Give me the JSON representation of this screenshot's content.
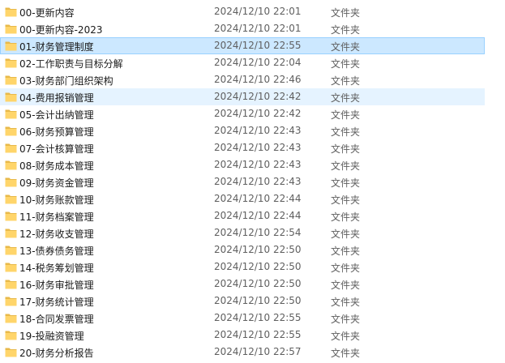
{
  "colors": {
    "selected_bg": "#cce8ff",
    "selected_border": "#99d1ff",
    "hover_bg": "#e5f3ff",
    "folder_fill": "#ffd56a",
    "folder_tab": "#e8b94a"
  },
  "rows": [
    {
      "name": "00-更新内容",
      "date": "2024/12/10 22:01",
      "type": "文件夹",
      "icon": "folder-icon",
      "state": ""
    },
    {
      "name": "00-更新内容-2023",
      "date": "2024/12/10 22:01",
      "type": "文件夹",
      "icon": "folder-icon",
      "state": ""
    },
    {
      "name": "01-财务管理制度",
      "date": "2024/12/10 22:55",
      "type": "文件夹",
      "icon": "folder-icon",
      "state": "selected"
    },
    {
      "name": "02-工作职责与目标分解",
      "date": "2024/12/10 22:04",
      "type": "文件夹",
      "icon": "folder-icon",
      "state": ""
    },
    {
      "name": "03-财务部门组织架构",
      "date": "2024/12/10 22:46",
      "type": "文件夹",
      "icon": "folder-icon",
      "state": ""
    },
    {
      "name": "04-费用报销管理",
      "date": "2024/12/10 22:42",
      "type": "文件夹",
      "icon": "folder-icon",
      "state": "hover"
    },
    {
      "name": "05-会计出纳管理",
      "date": "2024/12/10 22:42",
      "type": "文件夹",
      "icon": "folder-icon",
      "state": ""
    },
    {
      "name": "06-财务预算管理",
      "date": "2024/12/10 22:43",
      "type": "文件夹",
      "icon": "folder-icon",
      "state": ""
    },
    {
      "name": "07-会计核算管理",
      "date": "2024/12/10 22:43",
      "type": "文件夹",
      "icon": "folder-icon",
      "state": ""
    },
    {
      "name": "08-财务成本管理",
      "date": "2024/12/10 22:43",
      "type": "文件夹",
      "icon": "folder-icon",
      "state": ""
    },
    {
      "name": "09-财务资金管理",
      "date": "2024/12/10 22:43",
      "type": "文件夹",
      "icon": "folder-icon",
      "state": ""
    },
    {
      "name": "10-财务账款管理",
      "date": "2024/12/10 22:44",
      "type": "文件夹",
      "icon": "folder-icon",
      "state": ""
    },
    {
      "name": "11-财务档案管理",
      "date": "2024/12/10 22:44",
      "type": "文件夹",
      "icon": "folder-icon",
      "state": ""
    },
    {
      "name": "12-财务收支管理",
      "date": "2024/12/10 22:54",
      "type": "文件夹",
      "icon": "folder-icon",
      "state": ""
    },
    {
      "name": "13-债券债务管理",
      "date": "2024/12/10 22:50",
      "type": "文件夹",
      "icon": "folder-icon",
      "state": ""
    },
    {
      "name": "14-税务筹划管理",
      "date": "2024/12/10 22:50",
      "type": "文件夹",
      "icon": "folder-icon",
      "state": ""
    },
    {
      "name": "16-财务审批管理",
      "date": "2024/12/10 22:50",
      "type": "文件夹",
      "icon": "folder-icon",
      "state": ""
    },
    {
      "name": "17-财务统计管理",
      "date": "2024/12/10 22:50",
      "type": "文件夹",
      "icon": "folder-icon",
      "state": ""
    },
    {
      "name": "18-合同发票管理",
      "date": "2024/12/10 22:55",
      "type": "文件夹",
      "icon": "folder-icon",
      "state": ""
    },
    {
      "name": "19-投融资管理",
      "date": "2024/12/10 22:55",
      "type": "文件夹",
      "icon": "folder-icon",
      "state": ""
    },
    {
      "name": "20-财务分析报告",
      "date": "2024/12/10 22:57",
      "type": "文件夹",
      "icon": "folder-icon",
      "state": ""
    }
  ]
}
